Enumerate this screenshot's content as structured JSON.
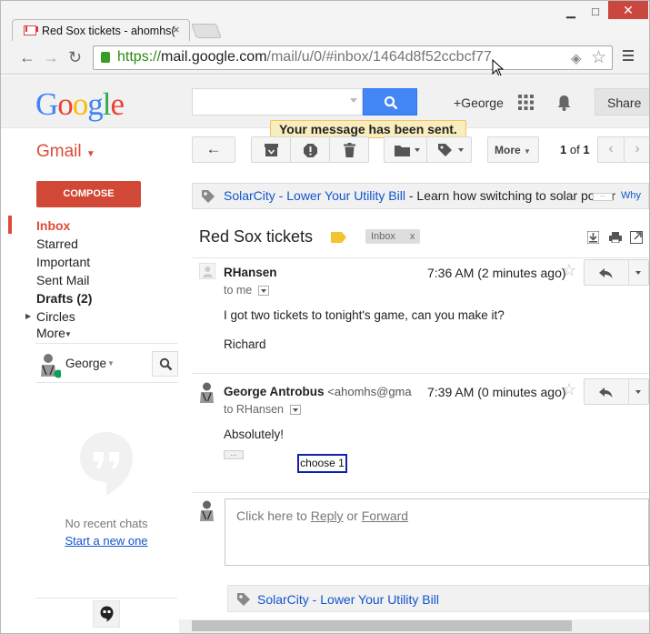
{
  "browser": {
    "tab_title": "Red Sox tickets - ahomhs(",
    "tab_close": "×",
    "url_scheme": "https://",
    "url_domain": "mail.google.com",
    "url_path": "/mail/u/0/#inbox/1464d8f52ccbcf77",
    "win_min": "▁",
    "win_max": "□",
    "win_close": "✕"
  },
  "google": {
    "logo_letters": [
      "G",
      "o",
      "o",
      "g",
      "l",
      "e"
    ],
    "logo_colors": [
      "#4285f4",
      "#ea4335",
      "#fbbc05",
      "#4285f4",
      "#34a853",
      "#ea4335"
    ],
    "user_link": "+George",
    "share_label": "Share"
  },
  "notification": "Your message has been sent.",
  "sidebar": {
    "gmail_label": "Gmail",
    "compose_label": "COMPOSE",
    "items": [
      {
        "label": "Inbox",
        "selected": true,
        "bold": true
      },
      {
        "label": "Starred",
        "selected": false,
        "bold": false
      },
      {
        "label": "Important",
        "selected": false,
        "bold": false
      },
      {
        "label": "Sent Mail",
        "selected": false,
        "bold": false
      },
      {
        "label": "Drafts (2)",
        "selected": false,
        "bold": true
      },
      {
        "label": "Circles",
        "selected": false,
        "bold": false
      },
      {
        "label": "More",
        "selected": false,
        "bold": false
      }
    ],
    "chat_user": "George",
    "no_chats": "No recent chats",
    "start_chat": "Start a new one"
  },
  "toolbar": {
    "more_label": "More",
    "page_current": "1",
    "page_of": "of",
    "page_total": "1"
  },
  "ad": {
    "advertiser": "SolarCity",
    "dash": " - ",
    "title": "Lower Your Utility Bill",
    "text": " - Learn how switching to solar power",
    "why": "Why"
  },
  "thread": {
    "subject": "Red Sox tickets",
    "label_tag": "Inbox",
    "label_remove": "x",
    "messages": [
      {
        "sender": "RHansen",
        "email": "",
        "time": "7:36 AM (2 minutes ago)",
        "to": "to me",
        "body_lines": [
          "I got two tickets to tonight's game, can you make it?",
          "Richard"
        ]
      },
      {
        "sender": "George Antrobus",
        "email": "<ahomhs@gma",
        "time": "7:39 AM (0 minutes ago)",
        "to": "to RHansen",
        "body_lines": [
          "Absolutely!"
        ]
      }
    ]
  },
  "reply_box": {
    "prefix": "Click here to ",
    "reply": "Reply",
    "or": " or ",
    "forward": "Forward"
  },
  "footer_ad": {
    "advertiser": "SolarCity",
    "dash": " - ",
    "title": "Lower Your Utility Bill"
  },
  "overlay_label": "choose 1"
}
